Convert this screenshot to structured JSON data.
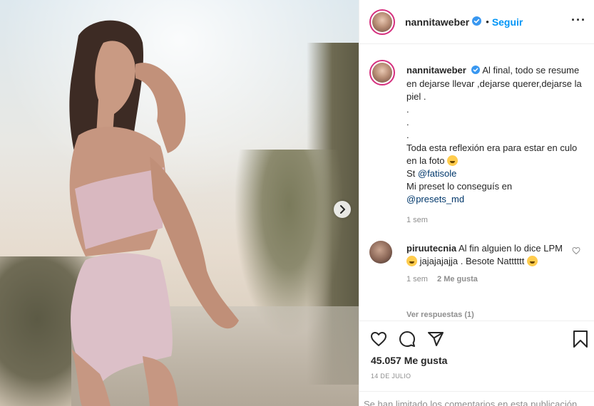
{
  "post": {
    "author": "nannitaweber",
    "follow_label": "Seguir",
    "dot": "•",
    "more_label": "···",
    "caption_lines": [
      "Al final, todo se resume en dejarse llevar ,dejarse querer,dejarse la piel .",
      ".",
      ".",
      ".",
      "Toda esta reflexión era para estar en culo en la foto",
      "St",
      "Mi preset lo conseguís en"
    ],
    "mention_photographer": "@fatisole",
    "mention_presets": "@presets_md",
    "caption_time": "1 sem",
    "likes": "45.057 Me gusta",
    "date": "14 DE JULIO",
    "comments_limited": "Se han limitado los comentarios en esta publicación."
  },
  "comment": {
    "author": "piruutecnia",
    "text_a": "Al fin alguien lo dice LPM",
    "text_b": "jajajajajja . Besote Natttttt",
    "time": "1 sem",
    "likes": "2 Me gusta",
    "view_replies": "Ver respuestas (1)"
  },
  "colors": {
    "accent": "#0095f6",
    "verified": "#3897f0",
    "ring": "#d52f7e",
    "muted": "#8e8e8e",
    "mention": "#00376b"
  },
  "icons": [
    "heart-icon",
    "comment-icon",
    "share-icon",
    "bookmark-icon",
    "verified-icon",
    "chevron-right-icon",
    "more-icon"
  ]
}
